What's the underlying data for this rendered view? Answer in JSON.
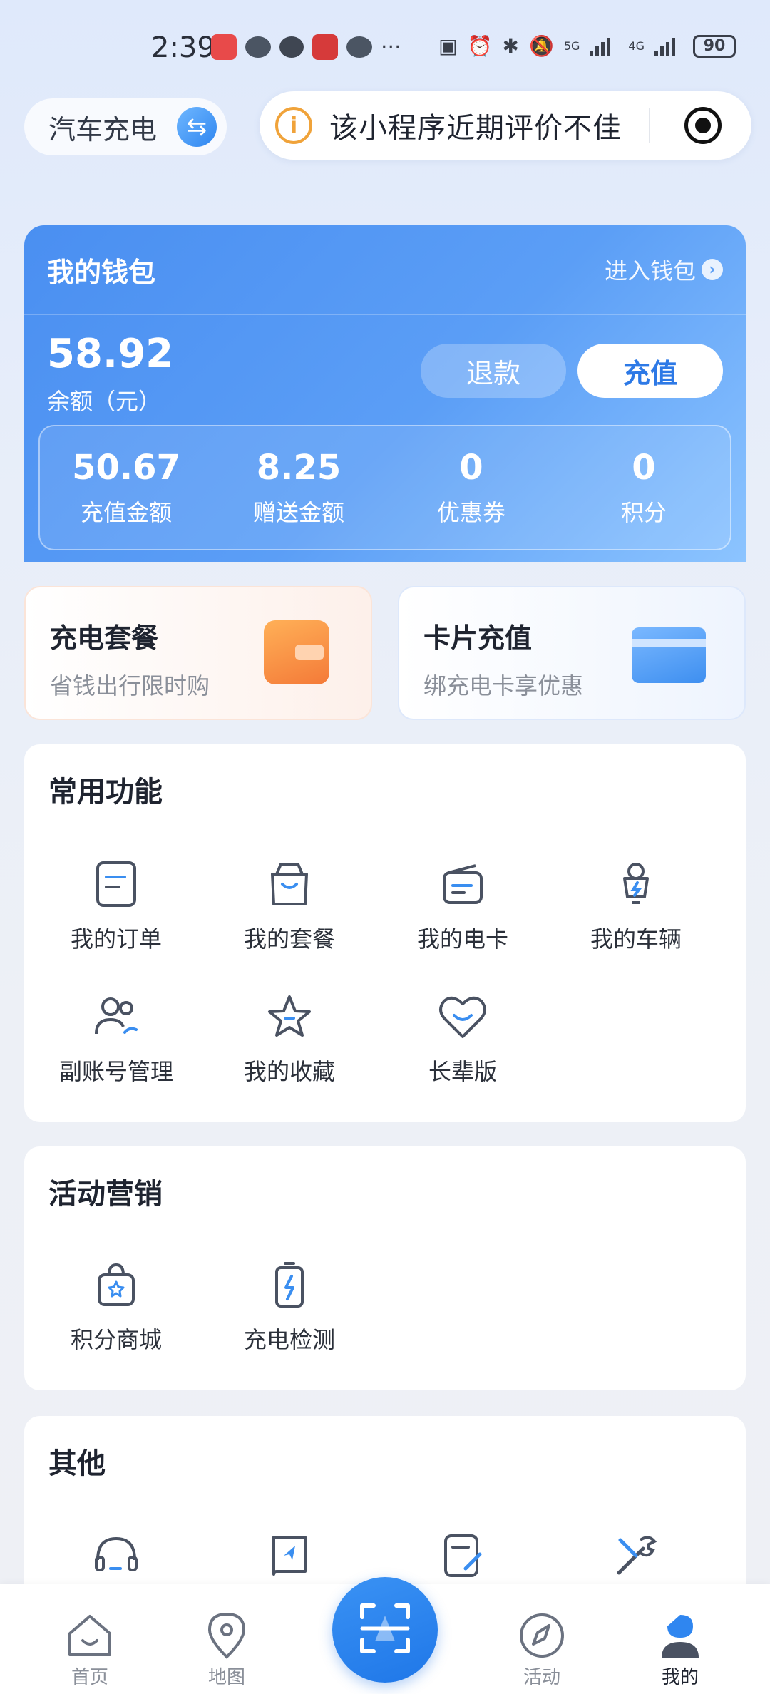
{
  "status_bar": {
    "time": "2:39",
    "battery": "90",
    "network_1": "5G",
    "network_2": "4G"
  },
  "header": {
    "switch_label": "汽车充电",
    "notice_text": "该小程序近期评价不佳"
  },
  "wallet": {
    "title": "我的钱包",
    "enter_label": "进入钱包",
    "balance": "58.92",
    "balance_label": "余额（元）",
    "refund_label": "退款",
    "topup_label": "充值",
    "stats": [
      {
        "value": "50.67",
        "label": "充值金额"
      },
      {
        "value": "8.25",
        "label": "赠送金额"
      },
      {
        "value": "0",
        "label": "优惠券"
      },
      {
        "value": "0",
        "label": "积分"
      }
    ]
  },
  "promos": [
    {
      "title": "充电套餐",
      "subtitle": "省钱出行限时购"
    },
    {
      "title": "卡片充值",
      "subtitle": "绑充电卡享优惠"
    }
  ],
  "common_functions": {
    "title": "常用功能",
    "items": [
      {
        "label": "我的订单",
        "icon": "order-icon"
      },
      {
        "label": "我的套餐",
        "icon": "package-icon"
      },
      {
        "label": "我的电卡",
        "icon": "card-icon"
      },
      {
        "label": "我的车辆",
        "icon": "vehicle-icon"
      },
      {
        "label": "副账号管理",
        "icon": "sub-account-icon"
      },
      {
        "label": "我的收藏",
        "icon": "star-icon"
      },
      {
        "label": "长辈版",
        "icon": "heart-icon"
      }
    ]
  },
  "marketing": {
    "title": "活动营销",
    "items": [
      {
        "label": "积分商城",
        "icon": "shopping-bag-icon"
      },
      {
        "label": "充电检测",
        "icon": "battery-check-icon"
      }
    ]
  },
  "others": {
    "title": "其他",
    "items": [
      {
        "icon": "headset-icon"
      },
      {
        "icon": "guide-book-icon"
      },
      {
        "icon": "feedback-edit-icon"
      },
      {
        "icon": "tools-icon"
      }
    ]
  },
  "bottom_nav": [
    {
      "label": "首页",
      "icon": "home-icon"
    },
    {
      "label": "地图",
      "icon": "location-icon"
    },
    {
      "label": "活动",
      "icon": "compass-icon"
    },
    {
      "label": "我的",
      "icon": "profile-icon"
    }
  ],
  "colors": {
    "accent": "#2d79e6",
    "wallet_start": "#4a8ff1",
    "wallet_end": "#8cc4ff",
    "icon_blue": "#3a8ef0",
    "icon_gray": "#4a5262"
  }
}
